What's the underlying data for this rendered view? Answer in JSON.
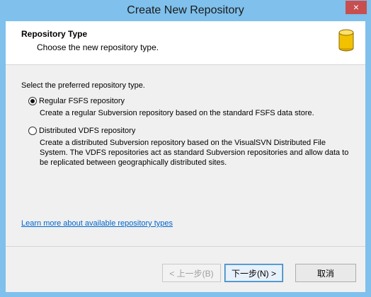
{
  "window": {
    "title": "Create New Repository",
    "close_label": "×"
  },
  "header": {
    "title": "Repository Type",
    "subtitle": "Choose the new repository type.",
    "icon": "database-icon"
  },
  "main": {
    "prompt": "Select the preferred repository type.",
    "options": [
      {
        "label": "Regular FSFS repository",
        "selected": true,
        "description": "Create a regular Subversion repository based on the standard FSFS data store."
      },
      {
        "label": "Distributed VDFS repository",
        "selected": false,
        "description": "Create a distributed Subversion repository based on the VisualSVN Distributed File System. The VDFS repositories act as standard Subversion repositories and allow data to be replicated between geographically distributed sites."
      }
    ],
    "learn_more_link": "Learn more about available repository types"
  },
  "footer": {
    "back_label": "< 上一步(B)",
    "next_label": "下一步(N) >",
    "cancel_label": "取消"
  },
  "colors": {
    "titlebar": "#7fc0ec",
    "close": "#c74f4f",
    "link": "#0066cc",
    "icon_yellow": "#f2c200"
  }
}
